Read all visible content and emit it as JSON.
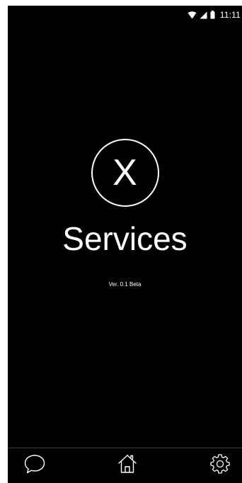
{
  "status_bar": {
    "time": "11:11",
    "icons": [
      "wifi-icon",
      "cell-signal-icon",
      "battery-icon"
    ]
  },
  "logo": {
    "letter": "X",
    "icon": "x-logo-circle-icon"
  },
  "app": {
    "title": "Services",
    "version": "Ver. 0.1 Beta"
  },
  "bottom_nav": {
    "items": [
      {
        "icon": "chat-bubble-icon"
      },
      {
        "icon": "home-icon"
      },
      {
        "icon": "gear-icon"
      }
    ]
  },
  "colors": {
    "background": "#000000",
    "foreground": "#ffffff"
  }
}
